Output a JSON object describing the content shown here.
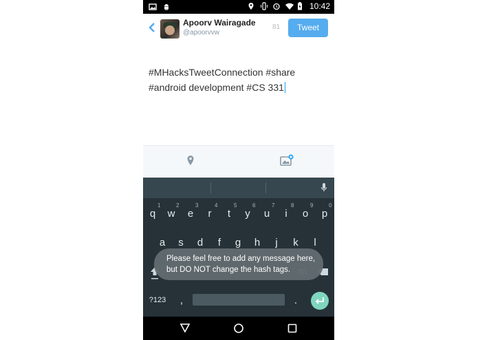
{
  "status_bar": {
    "time": "10:42",
    "icons_left": [
      "image-icon",
      "android-icon"
    ],
    "icons_right": [
      "location-icon",
      "vibrate-icon",
      "alarm-icon",
      "wifi-icon",
      "battery-icon"
    ]
  },
  "compose": {
    "back_icon": "chevron-left-icon",
    "user_name": "Apoorv Wairagade",
    "user_handle": "@apoorvvw",
    "char_count": "81",
    "tweet_label": "Tweet",
    "tweet_text_line1": "#MHacksTweetConnection #share",
    "tweet_text_line2": "#android development #CS 331"
  },
  "actions": {
    "location_icon": "location-pin-icon",
    "media_icon": "add-photo-icon"
  },
  "keyboard": {
    "row1": [
      "q",
      "w",
      "e",
      "r",
      "t",
      "y",
      "u",
      "i",
      "o",
      "p"
    ],
    "row1_hints": [
      "1",
      "2",
      "3",
      "4",
      "5",
      "6",
      "7",
      "8",
      "9",
      "0"
    ],
    "row2": [
      "a",
      "s",
      "d",
      "f",
      "g",
      "h",
      "j",
      "k",
      "l"
    ],
    "symbols_label": "?123",
    "comma": ",",
    "period": ".",
    "partial_m": "m"
  },
  "toast": {
    "line1": "Please feel free to add any message here,",
    "line2": "but DO NOT change the hash tags."
  },
  "colors": {
    "accent": "#55acee",
    "keyboard_bg": "#263238",
    "enter_key": "#7fd6bf"
  }
}
